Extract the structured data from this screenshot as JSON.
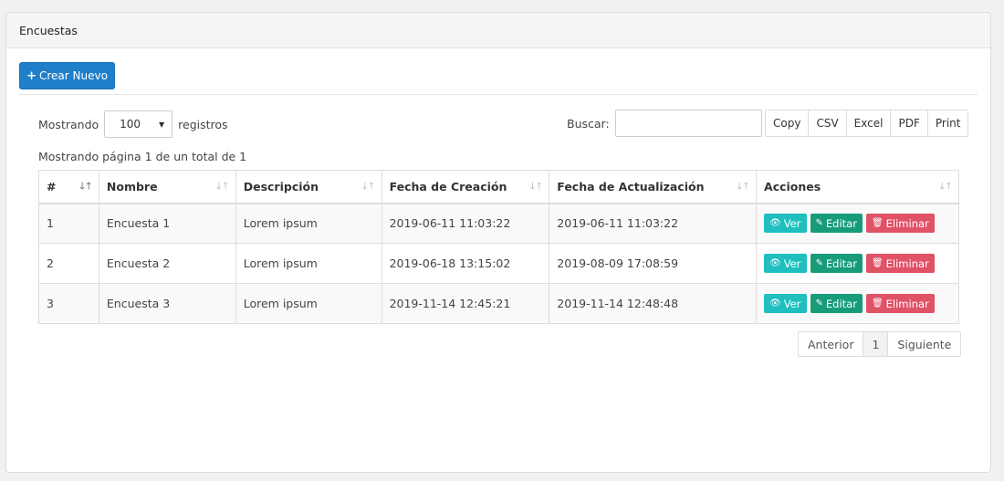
{
  "panel": {
    "title": "Encuestas"
  },
  "toolbar": {
    "create_icon": "+",
    "create_label": "Crear Nuevo"
  },
  "length": {
    "prefix": "Mostrando",
    "value": "100",
    "suffix": "registros"
  },
  "search": {
    "label": "Buscar:",
    "value": ""
  },
  "export": [
    "Copy",
    "CSV",
    "Excel",
    "PDF",
    "Print"
  ],
  "info": "Mostrando página 1 de un total de 1",
  "table": {
    "headers": [
      "#",
      "Nombre",
      "Descripción",
      "Fecha de Creación",
      "Fecha de Actualización",
      "Acciones"
    ],
    "rows": [
      [
        "1",
        "Encuesta 1",
        "Lorem ipsum",
        "2019-06-11 11:03:22",
        "2019-06-11 11:03:22"
      ],
      [
        "2",
        "Encuesta 2",
        "Lorem ipsum",
        "2019-06-18 13:15:02",
        "2019-08-09 17:08:59"
      ],
      [
        "3",
        "Encuesta 3",
        "Lorem ipsum",
        "2019-11-14 12:45:21",
        "2019-11-14 12:48:48"
      ]
    ],
    "actions": {
      "view": "Ver",
      "edit": "Editar",
      "delete": "Eliminar"
    }
  },
  "pagination": {
    "prev": "Anterior",
    "current": "1",
    "next": "Siguiente"
  },
  "colors": {
    "primary": "#1f7fc9",
    "view": "#1fbfbf",
    "edit": "#179c78",
    "delete": "#e05266"
  },
  "icons": {
    "view": "eye-icon",
    "edit": "edit-icon",
    "delete": "trash-icon",
    "sort": "sort-icon",
    "create": "plus-icon"
  }
}
